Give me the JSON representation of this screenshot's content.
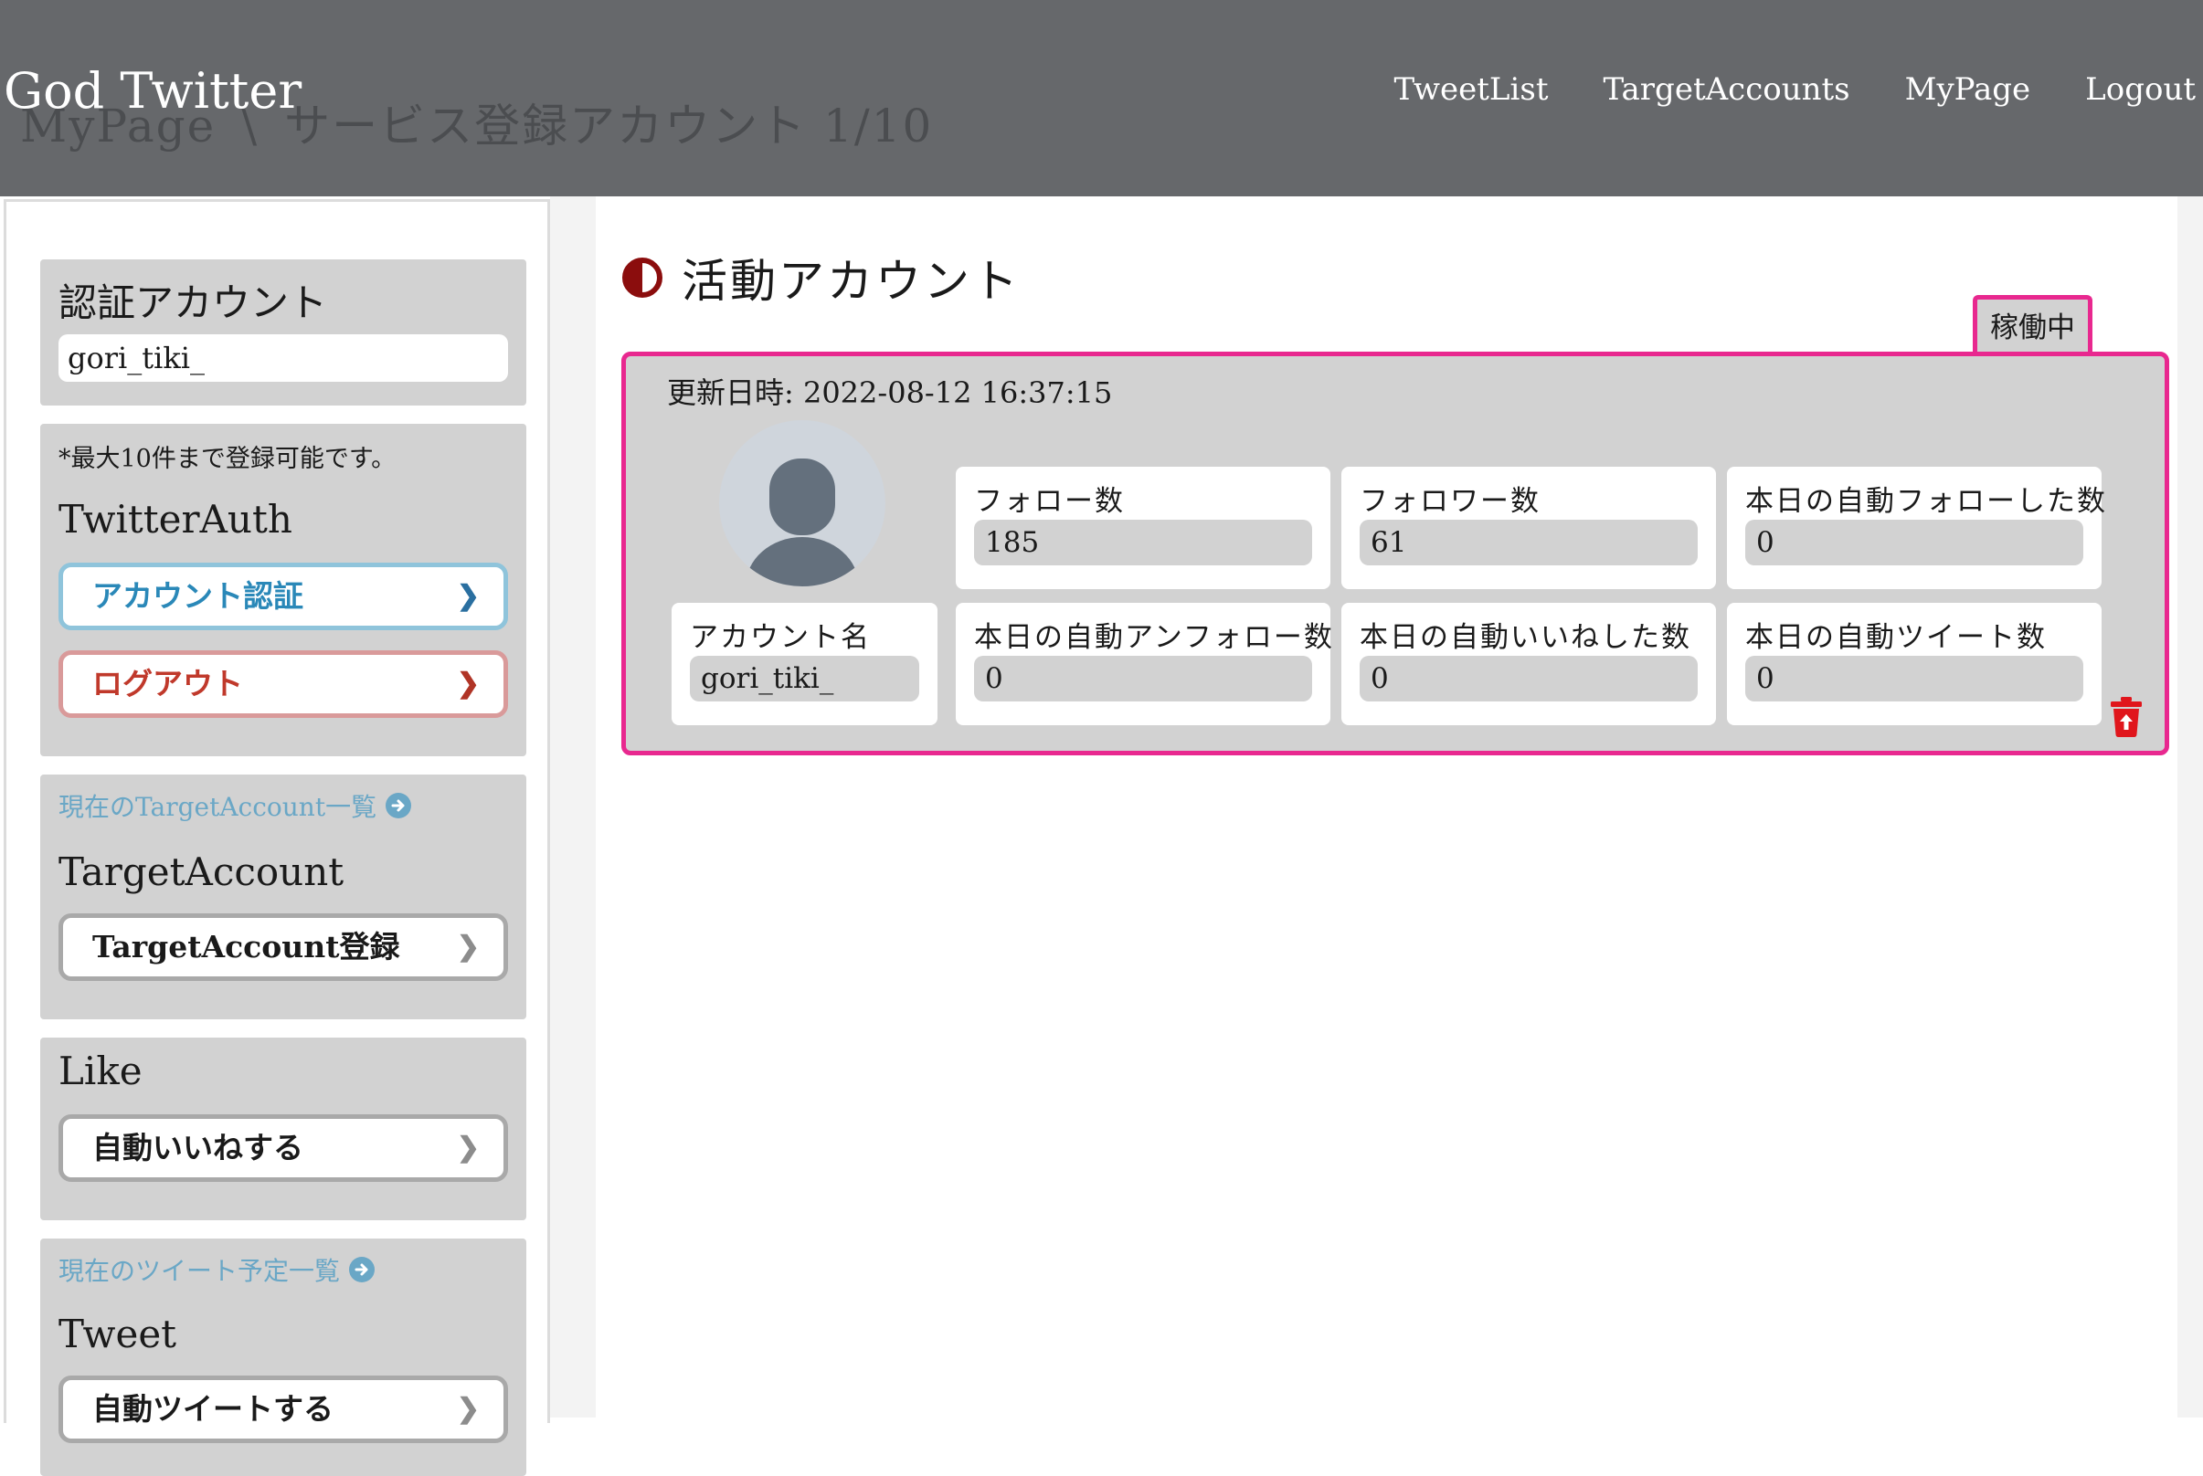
{
  "header": {
    "brand": "God Twitter",
    "breadcrumb": {
      "root": "MyPage",
      "separator": "\\",
      "current": "サービス登録アカウント 1/10"
    },
    "nav": [
      "TweetList",
      "TargetAccounts",
      "MyPage",
      "Logout"
    ],
    "colors": {
      "background": "#66686b",
      "text": "#ffffff"
    }
  },
  "sidebar": {
    "auth_card": {
      "title": "認証アカウント",
      "account": "gori_tiki_"
    },
    "twitter_auth_card": {
      "note": "*最大10件まで登録可能です。",
      "title": "TwitterAuth",
      "buttons": [
        {
          "label": "アカウント認証",
          "color": "#2a88b8"
        },
        {
          "label": "ログアウト",
          "color": "#c0392b"
        }
      ]
    },
    "target_card": {
      "link": "現在のTargetAccount一覧",
      "title": "TargetAccount",
      "button": "TargetAccount登録"
    },
    "like_card": {
      "title": "Like",
      "button": "自動いいねする"
    },
    "tweet_card": {
      "link": "現在のツイート予定一覧",
      "title": "Tweet",
      "button": "自動ツイートする"
    }
  },
  "main": {
    "section_title": "活動アカウント",
    "status": "稼働中",
    "updated_at": "更新日時: 2022-08-12 16:37:15",
    "account": {
      "label": "アカウント名",
      "value": "gori_tiki_"
    },
    "stats": [
      {
        "label": "フォロー数",
        "value": "185"
      },
      {
        "label": "フォロワー数",
        "value": "61"
      },
      {
        "label": "本日の自動フォローした数",
        "value": "0"
      },
      {
        "label": "本日の自動アンフォロー数",
        "value": "0"
      },
      {
        "label": "本日の自動いいねした数",
        "value": "0"
      },
      {
        "label": "本日の自動ツイート数",
        "value": "0"
      }
    ],
    "icons": [
      "half-circle-icon",
      "avatar-placeholder-icon",
      "trash-icon"
    ],
    "colors": {
      "panel_border": "#e8288f",
      "panel_bg": "#d2d2d2",
      "trash": "#e0161c"
    }
  }
}
